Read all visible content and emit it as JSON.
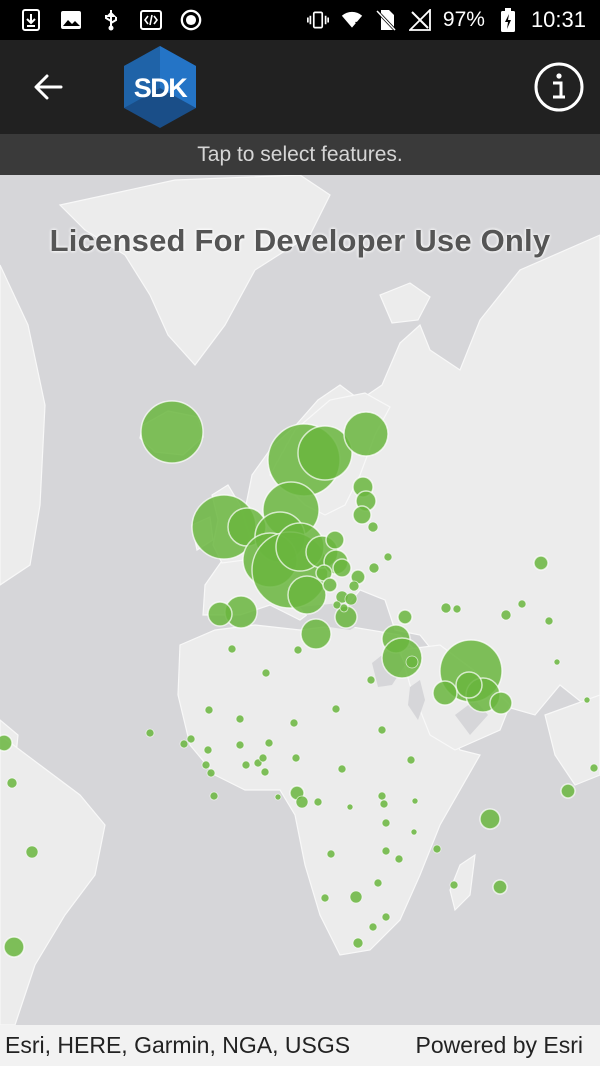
{
  "status_bar": {
    "battery_percent": "97%",
    "time": "10:31",
    "icons": [
      "download-icon",
      "image-icon",
      "usb-icon",
      "code-icon",
      "record-icon",
      "vibrate-icon",
      "wifi-icon",
      "no-sim-icon",
      "no-signal-icon",
      "battery-charging-icon"
    ]
  },
  "app_bar": {
    "logo_text": "SDK",
    "back_icon": "arrow-back-icon",
    "info_icon": "info-icon"
  },
  "instruction": "Tap to select features.",
  "map": {
    "watermark": "Licensed For Developer Use Only",
    "feature_color": "#6ab63e",
    "land_color": "#ececec",
    "water_color": "#d6d6d9"
  },
  "attribution": {
    "sources": "Esri, HERE, Garmin, NGA, USGS",
    "powered_by": "Powered by Esri"
  }
}
